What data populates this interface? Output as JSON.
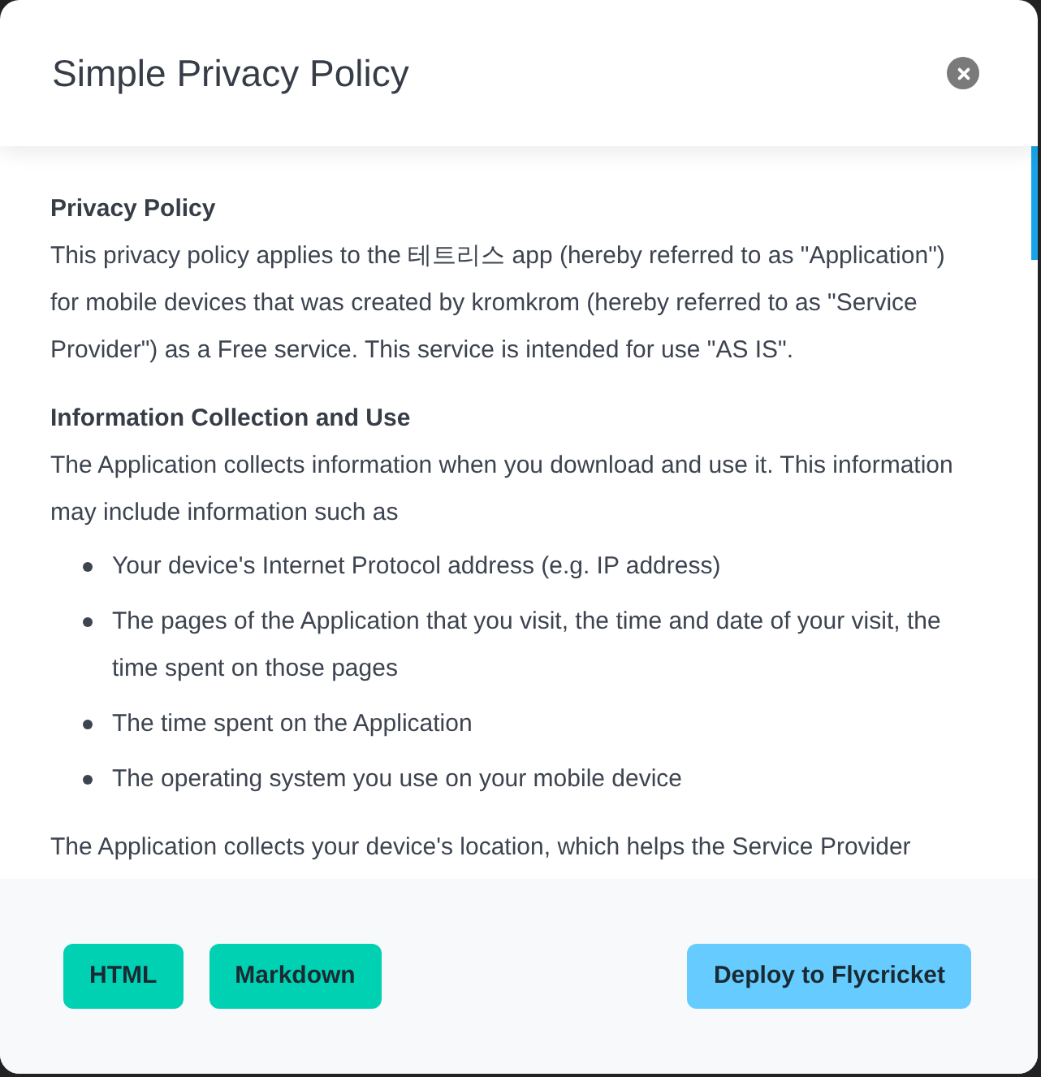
{
  "modal": {
    "title": "Simple Privacy Policy"
  },
  "sections": [
    {
      "kind": "paragraph",
      "heading": "Privacy Policy",
      "text": "This privacy policy applies to the 테트리스 app (hereby referred to as \"Application\") for mobile devices that was created by kromkrom (hereby referred to as \"Service Provider\") as a Free service. This service is intended for use \"AS IS\"."
    },
    {
      "kind": "list",
      "heading": "Information Collection and Use",
      "text": "The Application collects information when you download and use it. This information may include information such as",
      "items": [
        "Your device's Internet Protocol address (e.g. IP address)",
        "The pages of the Application that you visit, the time and date of your visit, the time spent on those pages",
        "The time spent on the Application",
        "The operating system you use on your mobile device"
      ]
    },
    {
      "kind": "paragraph",
      "text": "The Application collects your device's location, which helps the Service Provider"
    }
  ],
  "buttons": [
    {
      "label": "HTML",
      "kind": "export"
    },
    {
      "label": "Markdown",
      "kind": "export"
    },
    {
      "label": "Deploy to Flycricket",
      "kind": "deploy"
    }
  ]
}
